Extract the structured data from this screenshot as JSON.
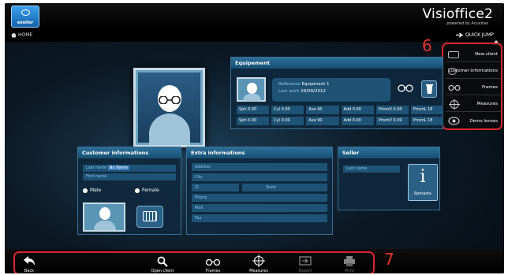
{
  "app": {
    "brand": "essilor",
    "title": "Visioffice2",
    "subtitle": "powered by Acuvitax"
  },
  "nav": {
    "home_label": "HOME"
  },
  "quick_jump": {
    "label": "QUICK JUMP",
    "items": [
      {
        "label": "New client",
        "icon": "new-client-icon"
      },
      {
        "label": "Customer informations",
        "icon": "customer-info-icon"
      },
      {
        "label": "Frames",
        "icon": "frames-icon"
      },
      {
        "label": "Measures",
        "icon": "measures-icon"
      },
      {
        "label": "Demo lenses",
        "icon": "demo-lenses-icon"
      }
    ]
  },
  "annotations": {
    "quick_jump_number": "6",
    "toolbar_number": "7"
  },
  "equipment": {
    "title": "Equipement",
    "reference_label": "Reference",
    "reference_value": "Equipment 1",
    "last_work_label": "Last work",
    "last_work_value": "26/09/2012",
    "rows": [
      [
        "Sph 0.00",
        "Cyl 0.00",
        "Axe 90",
        "Add 0.00",
        "PrismV 0.00",
        "PrismL 18"
      ],
      [
        "Sph 0.00",
        "Cyl 0.00",
        "Axe 90",
        "Add 0.00",
        "PrismV 0.00",
        "PrismL 18"
      ]
    ]
  },
  "customer": {
    "title": "Customer informations",
    "last_name_label": "Last name",
    "last_name_value": "No Name",
    "first_name_label": "First name",
    "male_label": "Male",
    "female_label": "Female"
  },
  "extra": {
    "title": "Extra informations",
    "address_label": "Address",
    "city_label": "City",
    "zip_label": "Zi",
    "state_label": "State",
    "phone_label": "Phone",
    "mail_label": "Mail",
    "fax_label": "Fax"
  },
  "seller": {
    "title": "Seller",
    "last_name_label": "Last name",
    "remarks_label": "Remarks"
  },
  "toolbar": {
    "back": "Back",
    "open_client": "Open client",
    "frames": "Frames",
    "measures": "Measures",
    "export": "Export",
    "print": "Print"
  }
}
